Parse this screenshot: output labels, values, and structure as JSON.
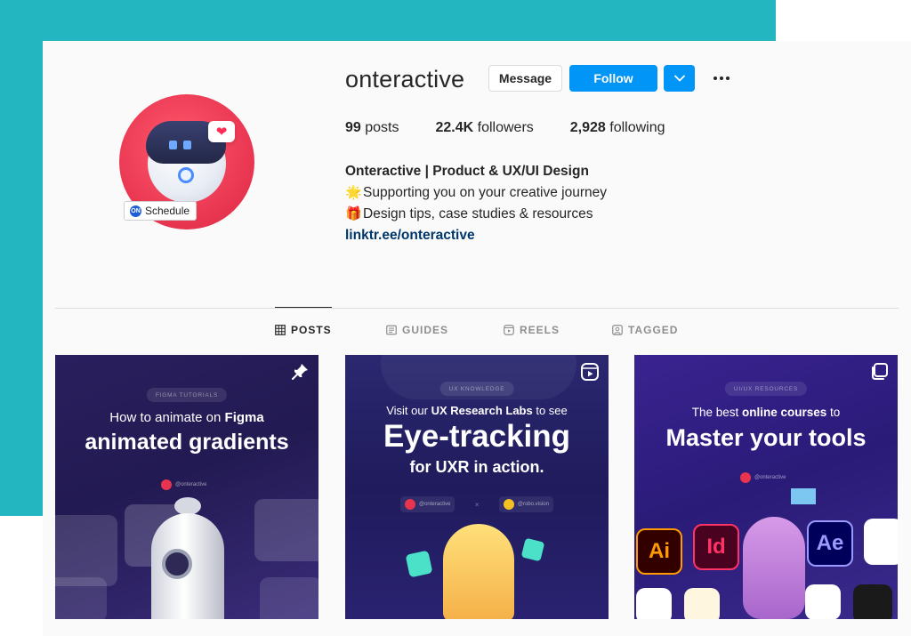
{
  "profile": {
    "username": "onteractive",
    "avatar_badge_label": "Schedule",
    "buttons": {
      "message": "Message",
      "follow": "Follow",
      "dropdown_icon": "chevron-down-icon",
      "more_icon": "more-options-icon"
    },
    "stats": {
      "posts_count": "99",
      "posts_label": " posts",
      "followers_count": "22.4K",
      "followers_label": " followers",
      "following_count": "2,928",
      "following_label": " following"
    },
    "bio": {
      "name": "Onteractive | Product & UX/UI Design",
      "line1_emoji": "🌟",
      "line1": "Supporting you on your creative journey",
      "line2_emoji": "🎁",
      "line2": "Design tips, case studies & resources",
      "link": "linktr.ee/onteractive"
    }
  },
  "tabs": [
    {
      "label": "POSTS",
      "icon": "grid-icon",
      "active": true
    },
    {
      "label": "GUIDES",
      "icon": "guides-icon",
      "active": false
    },
    {
      "label": "REELS",
      "icon": "reels-icon",
      "active": false
    },
    {
      "label": "TAGGED",
      "icon": "tagged-icon",
      "active": false
    }
  ],
  "posts": [
    {
      "pill": "FIGMA TUTORIALS",
      "line1_prefix": "How to animate on ",
      "line1_accent": "Figma",
      "line2": "animated gradients",
      "handle": "@onteractive",
      "corner_icon": "pin-icon"
    },
    {
      "pill": "UX KNOWLEDGE",
      "line1_prefix": "Visit our ",
      "line1_accent": "UX Research Labs",
      "line1_suffix": " to see",
      "line2": "Eye-tracking",
      "line3": "for UXR in action.",
      "handle_a": "@onteractive",
      "handle_b": "@robo.vision",
      "corner_icon": "reels-icon"
    },
    {
      "pill": "UI/UX RESOURCES",
      "line1_prefix": "The best ",
      "line1_accent": "online courses",
      "line1_suffix": " to",
      "line2": "Master your tools",
      "handle": "@onteractive",
      "app_icons": [
        "Ai",
        "Id",
        "Ae"
      ],
      "corner_icon": "carousel-icon"
    }
  ],
  "colors": {
    "teal_background": "#23b5c0",
    "follow_blue": "#0095f6",
    "link_blue": "#00376b",
    "avatar_red": "#e8344f"
  }
}
